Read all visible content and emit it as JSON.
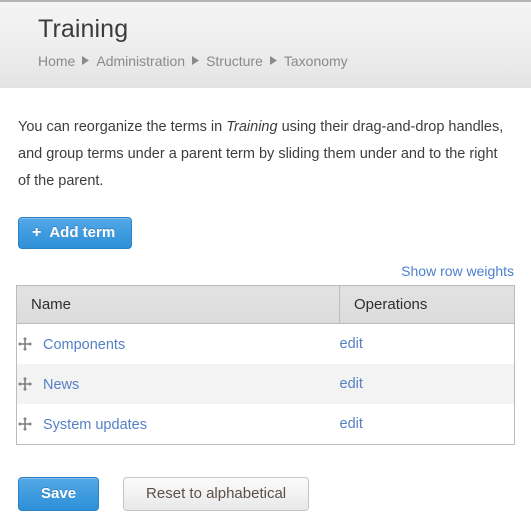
{
  "header": {
    "title": "Training",
    "breadcrumb": [
      {
        "label": "Home"
      },
      {
        "label": "Administration"
      },
      {
        "label": "Structure"
      },
      {
        "label": "Taxonomy"
      }
    ],
    "separator_icon": "triangle-right-icon"
  },
  "intro": {
    "part1": "You can reorganize the terms in ",
    "emphasis": "Training",
    "part2": " using their drag-and-drop handles, and group terms under a parent term by sliding them under and to the right of the parent."
  },
  "toolbar": {
    "add_term_plus": "+",
    "add_term_label": "Add term",
    "show_row_weights_label": "Show row weights"
  },
  "table": {
    "columns": [
      "Name",
      "Operations"
    ],
    "rows": [
      {
        "handle_icon": "drag-move-icon",
        "name": "Components",
        "operation": "edit"
      },
      {
        "handle_icon": "drag-move-icon",
        "name": "News",
        "operation": "edit"
      },
      {
        "handle_icon": "drag-move-icon",
        "name": "System updates",
        "operation": "edit"
      }
    ]
  },
  "actions": {
    "save_label": "Save",
    "reset_label": "Reset to alphabetical"
  },
  "colors": {
    "primary": "#3d9ade",
    "link": "#4c7fd0",
    "term_link": "#5580c4",
    "header_band": "#ececec",
    "table_border": "#bcbcbc",
    "row_alt": "#f3f3f3"
  }
}
